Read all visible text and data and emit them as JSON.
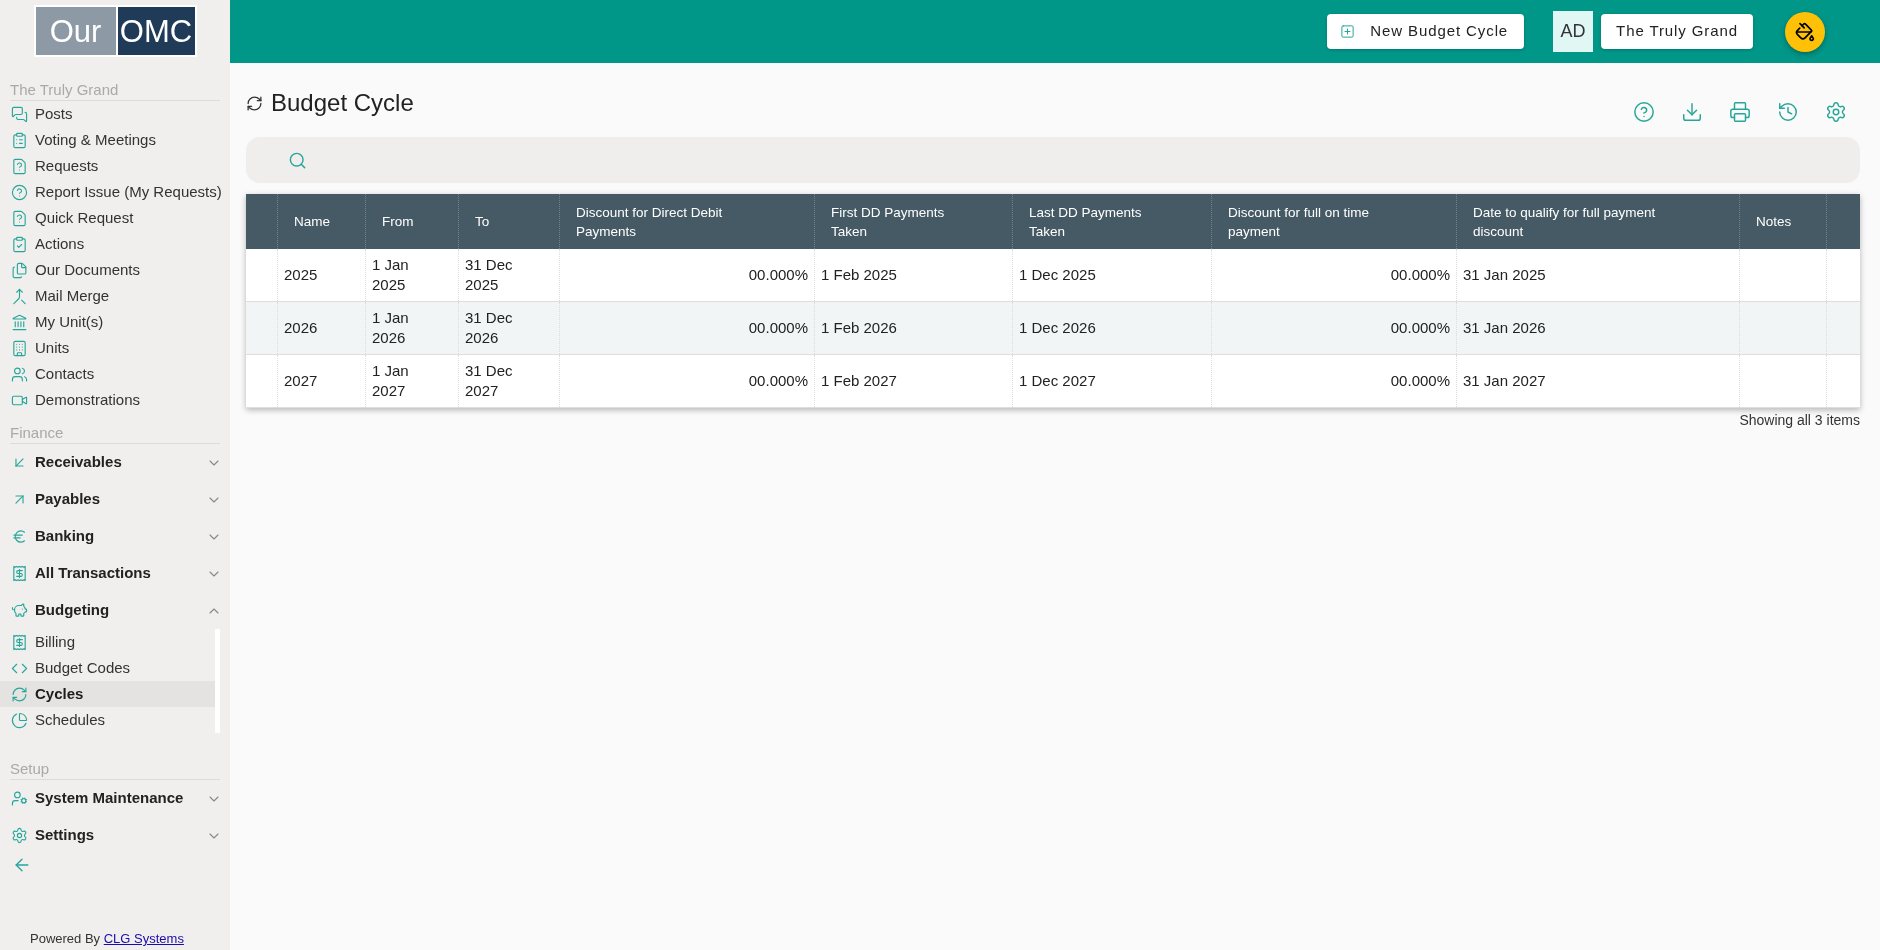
{
  "logo": {
    "words": [
      "Our",
      "OMC"
    ]
  },
  "header": {
    "new_button": {
      "label": "New Budget Cycle"
    },
    "avatar": {
      "initials": "AD"
    },
    "account_button": {
      "label": "The Truly Grand"
    }
  },
  "sidebar": {
    "sections": [
      {
        "title": "The Truly Grand",
        "items": [
          {
            "kind": "link",
            "label": "Posts",
            "selected": false
          },
          {
            "kind": "link",
            "label": "Voting & Meetings",
            "selected": false
          },
          {
            "kind": "link",
            "label": "Requests",
            "selected": false
          },
          {
            "kind": "link",
            "label": "Report Issue (My Requests)",
            "selected": false
          },
          {
            "kind": "link",
            "label": "Quick Request",
            "selected": false
          },
          {
            "kind": "link",
            "label": "Actions",
            "selected": false
          },
          {
            "kind": "link",
            "label": "Our Documents",
            "selected": false
          },
          {
            "kind": "link",
            "label": "Mail Merge",
            "selected": false
          },
          {
            "kind": "link",
            "label": "My Unit(s)",
            "selected": false
          },
          {
            "kind": "link",
            "label": "Units",
            "selected": false
          },
          {
            "kind": "link",
            "label": "Contacts",
            "selected": false
          },
          {
            "kind": "link",
            "label": "Demonstrations",
            "selected": false
          }
        ]
      },
      {
        "title": "Finance",
        "items": [
          {
            "kind": "group",
            "label": "Receivables",
            "selected": false,
            "expanded": false
          },
          {
            "kind": "group",
            "label": "Payables",
            "selected": false,
            "expanded": false
          },
          {
            "kind": "group",
            "label": "Banking",
            "selected": false,
            "expanded": false
          },
          {
            "kind": "group",
            "label": "All Transactions",
            "selected": false,
            "expanded": false
          },
          {
            "kind": "group",
            "label": "Budgeting",
            "selected": false,
            "expanded": true,
            "children": [
              {
                "kind": "link",
                "label": "Billing",
                "selected": false
              },
              {
                "kind": "link",
                "label": "Budget Codes",
                "selected": false
              },
              {
                "kind": "link",
                "label": "Cycles",
                "selected": true
              },
              {
                "kind": "link",
                "label": "Schedules",
                "selected": false
              }
            ]
          }
        ]
      },
      {
        "title": "Setup",
        "items": [
          {
            "kind": "group",
            "label": "System Maintenance",
            "selected": false,
            "expanded": false
          },
          {
            "kind": "group",
            "label": "Settings",
            "selected": false,
            "expanded": false
          }
        ]
      }
    ],
    "footer": {
      "text": "Powered By",
      "link": "CLG Systems"
    }
  },
  "page": {
    "title": "Budget Cycle"
  },
  "table": {
    "columns": [
      {
        "label": "Name",
        "kind": "text"
      },
      {
        "label": "From",
        "kind": "text"
      },
      {
        "label": "To",
        "kind": "text"
      },
      {
        "label": "Discount for Direct Debit Payments",
        "kind": "percent"
      },
      {
        "label": "First DD Payments Taken",
        "kind": "text"
      },
      {
        "label": "Last DD Payments Taken",
        "kind": "text"
      },
      {
        "label": "Discount for full on time payment",
        "kind": "percent"
      },
      {
        "label": "Date to qualify for full payment discount",
        "kind": "text"
      },
      {
        "label": "Notes",
        "kind": "text"
      }
    ],
    "rows": [
      {
        "cells": [
          "2025",
          "1 Jan 2025",
          "31 Dec 2025",
          "00.000%",
          "1 Feb 2025",
          "1 Dec 2025",
          "00.000%",
          "31 Jan 2025"
        ]
      },
      {
        "cells": [
          "2026",
          "1 Jan 2026",
          "31 Dec 2026",
          "00.000%",
          "1 Feb 2026",
          "1 Dec 2026",
          "00.000%",
          "31 Jan 2026"
        ]
      },
      {
        "cells": [
          "2027",
          "1 Jan 2027",
          "31 Dec 2027",
          "00.000%",
          "1 Feb 2027",
          "1 Dec 2027",
          "00.000%",
          "31 Jan 2027"
        ]
      }
    ],
    "footer": "Showing all 3 items"
  }
}
